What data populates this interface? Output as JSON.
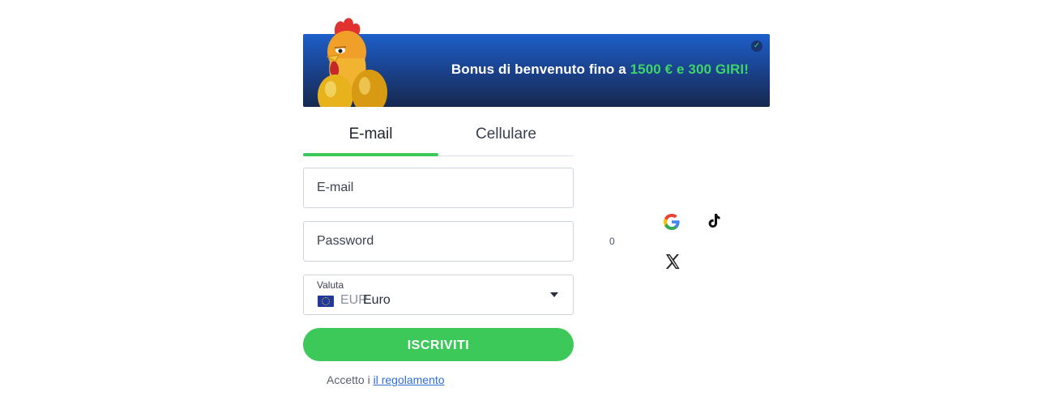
{
  "banner": {
    "text_prefix": "Bonus di benvenuto fino a ",
    "text_highlight": "1500 € e 300 GIRI!",
    "check_icon": "✓"
  },
  "tabs": [
    {
      "label": "E-mail",
      "active": true
    },
    {
      "label": "Cellulare",
      "active": false
    }
  ],
  "form": {
    "email_placeholder": "E-mail",
    "email_value": "",
    "password_placeholder": "Password",
    "password_value": "",
    "currency": {
      "label": "Valuta",
      "code": "EUR",
      "name": "Euro"
    },
    "submit_label": "ISCRIVITI",
    "terms_prefix": "Accetto i ",
    "terms_link": "il regolamento"
  },
  "side": {
    "counter": "0",
    "social_icons": [
      "google-icon",
      "tiktok-icon",
      "x-icon"
    ]
  },
  "colors": {
    "accent": "#3cc95a",
    "link": "#2f6fd8",
    "banner_top": "#1d5fc9",
    "banner_bottom": "#16294f"
  }
}
